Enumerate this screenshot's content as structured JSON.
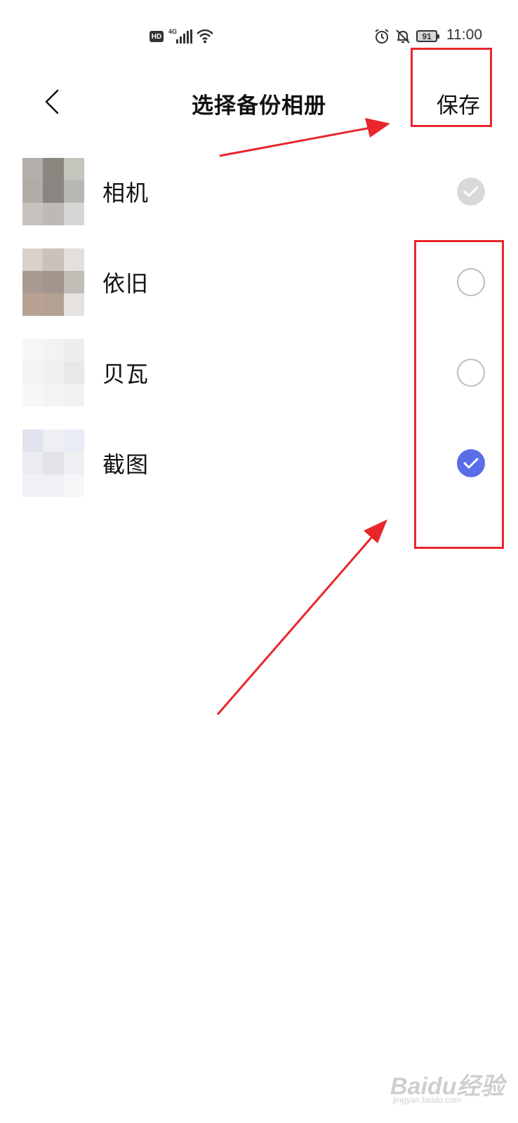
{
  "status_bar": {
    "hd": "HD",
    "network": "4G",
    "battery": "91",
    "time": "11:00"
  },
  "header": {
    "title": "选择备份相册",
    "save_label": "保存"
  },
  "albums": [
    {
      "name": "相机",
      "state": "disabled-checked"
    },
    {
      "name": "依旧",
      "state": "unchecked"
    },
    {
      "name": "贝瓦",
      "state": "unchecked"
    },
    {
      "name": "截图",
      "state": "checked"
    }
  ],
  "colors": {
    "accent": "#5a6ee8",
    "annotation": "#e8262b",
    "disabled_check": "#d9d9d9"
  },
  "watermark": {
    "logo": "Baidu经验",
    "url": "jingyan.baidu.com"
  }
}
